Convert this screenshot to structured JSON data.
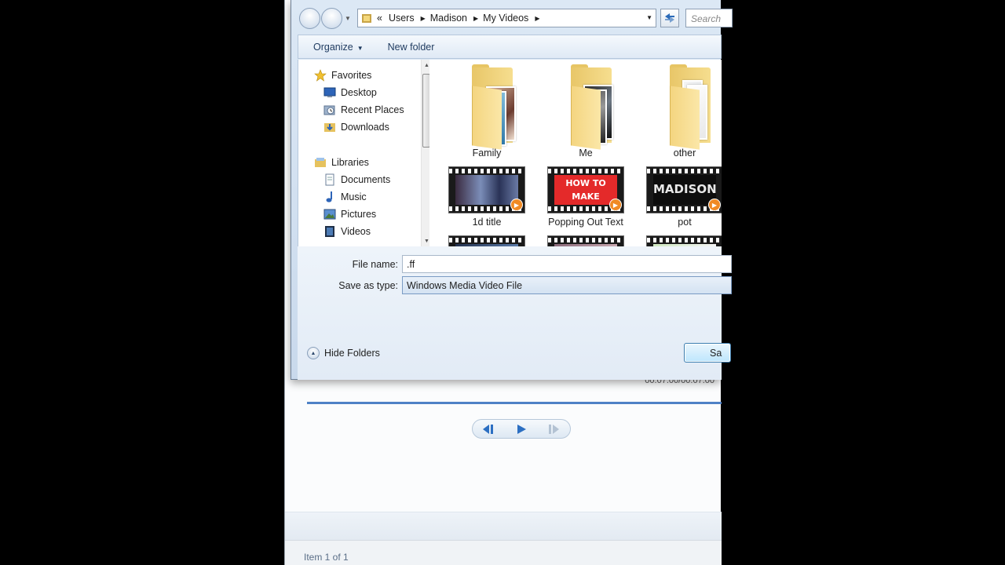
{
  "dialog": {
    "breadcrumb": [
      "Users",
      "Madison",
      "My Videos"
    ],
    "breadcrumb_prefix": "«",
    "search_placeholder": "Search",
    "toolbar": {
      "organize_label": "Organize",
      "new_folder_label": "New folder"
    },
    "navigation": {
      "favorites": {
        "label": "Favorites",
        "items": [
          "Desktop",
          "Recent Places",
          "Downloads"
        ]
      },
      "libraries": {
        "label": "Libraries",
        "items": [
          "Documents",
          "Music",
          "Pictures",
          "Videos"
        ]
      }
    },
    "files": {
      "folders": [
        {
          "name": "Family"
        },
        {
          "name": "Me"
        },
        {
          "name": "other"
        }
      ],
      "videos": [
        {
          "name": "1d title",
          "thumb_text": ""
        },
        {
          "name": "Popping Out Text",
          "thumb_text": "HOW TO MAKE OPPING OUT TEX"
        },
        {
          "name": "pot",
          "thumb_text": "MADISON"
        }
      ]
    },
    "form": {
      "file_name_label": "File name:",
      "file_name_value": ".ff",
      "save_as_type_label": "Save as type:",
      "save_as_type_value": "Windows Media Video File"
    },
    "hide_folders_label": "Hide Folders",
    "save_label": "Sa"
  },
  "player": {
    "status_text": "Item 1 of 1",
    "timecode": "00:07.00/00:07.00",
    "accent_color": "#4f82c6"
  }
}
